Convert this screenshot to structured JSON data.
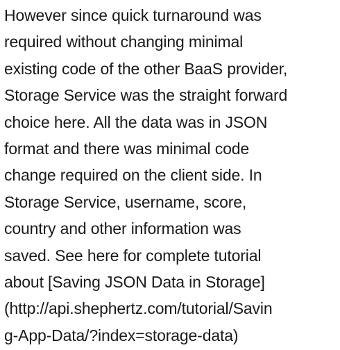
{
  "document": {
    "lines": [
      "However since quick turnaround was",
      "required without changing minimal",
      "existing code of the other BaaS provider,",
      "Storage Service was the straight forward",
      "choice here. All the data was in JSON",
      "format and there was minimal code",
      "change required on the client side. In",
      "Storage Service, username, score,",
      "country and other information was",
      "saved. See here for complete tutorial",
      "about [Saving JSON Data in Storage]",
      "(http://api.shephertz.com/tutorial/Savin",
      "g-App-Data/?index=storage-data)"
    ]
  }
}
